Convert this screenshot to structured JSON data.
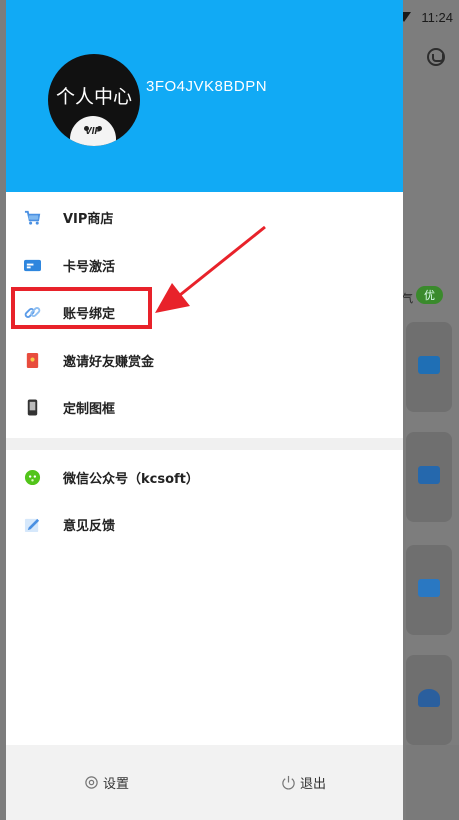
{
  "status_bar": {
    "time": "11:24"
  },
  "background": {
    "badge": "优",
    "side_text": "气"
  },
  "header": {
    "avatar_text": "个人中心",
    "avatar_badge": "VIP",
    "user_id": "3FO4JVK8BDPN"
  },
  "menu": {
    "group1": [
      {
        "label": "VIP商店",
        "icon": "shopping-cart-icon",
        "color": "#4a90e2"
      },
      {
        "label": "卡号激活",
        "icon": "card-icon",
        "color": "#2e86de"
      },
      {
        "label": "账号绑定",
        "icon": "link-icon",
        "color": "#5b9be8"
      },
      {
        "label": "邀请好友赚赏金",
        "icon": "red-envelope-icon",
        "color": "#e84c3d"
      },
      {
        "label": "定制图框",
        "icon": "phone-frame-icon",
        "color": "#333333"
      }
    ],
    "group2": [
      {
        "label": "微信公众号（kcsoft）",
        "icon": "wechat-icon",
        "color": "#52c41a"
      },
      {
        "label": "意见反馈",
        "icon": "feedback-edit-icon",
        "color": "#4a90e2"
      }
    ]
  },
  "footer": {
    "settings_label": "设置",
    "logout_label": "退出"
  },
  "colors": {
    "header_bg": "#11aaf5",
    "highlight": "#e8222a",
    "badge": "#3a8a2c"
  }
}
